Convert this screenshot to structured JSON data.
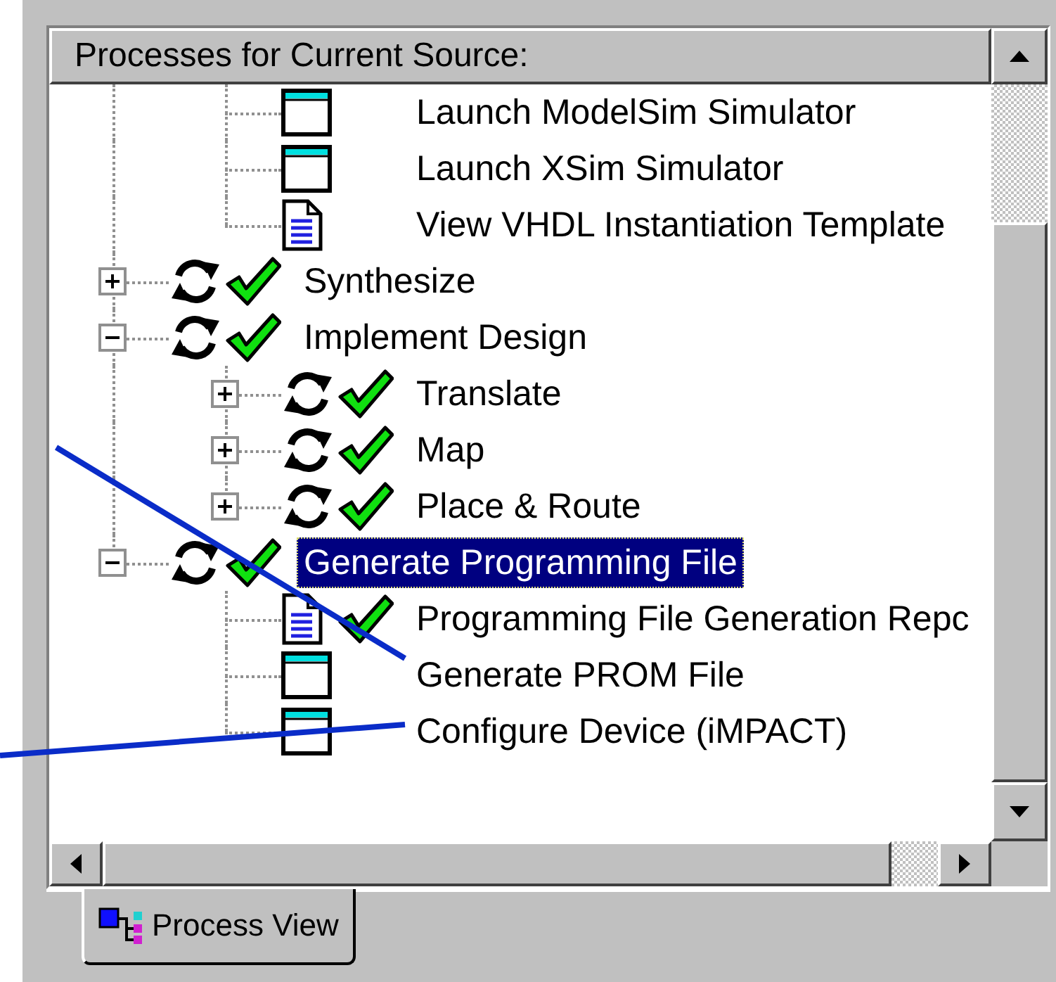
{
  "panel": {
    "title": "Processes for Current Source:"
  },
  "tree": {
    "scrolled_parent_children": [
      {
        "label": "Launch ModelSim Simulator",
        "kind": "tool",
        "done": false,
        "selected": false
      },
      {
        "label": "Launch XSim Simulator",
        "kind": "tool",
        "done": false,
        "selected": false
      },
      {
        "label": "View VHDL Instantiation Template",
        "kind": "doc",
        "done": false,
        "selected": false
      }
    ],
    "items": [
      {
        "label": "Synthesize",
        "kind": "process",
        "done": true,
        "expanded": false,
        "selected": false
      },
      {
        "label": "Implement Design",
        "kind": "process",
        "done": true,
        "expanded": true,
        "selected": false,
        "children": [
          {
            "label": "Translate",
            "kind": "process",
            "done": true,
            "expanded": false,
            "selected": false
          },
          {
            "label": "Map",
            "kind": "process",
            "done": true,
            "expanded": false,
            "selected": false
          },
          {
            "label": "Place & Route",
            "kind": "process",
            "done": true,
            "expanded": false,
            "selected": false
          }
        ]
      },
      {
        "label": "Generate Programming File",
        "kind": "process",
        "done": true,
        "expanded": true,
        "selected": true,
        "children": [
          {
            "label": "Programming File Generation Repc",
            "kind": "doc",
            "done": true,
            "selected": false
          },
          {
            "label": "Generate PROM File",
            "kind": "tool",
            "done": false,
            "selected": false
          },
          {
            "label": "Configure Device (iMPACT)",
            "kind": "tool",
            "done": false,
            "selected": false
          }
        ]
      }
    ]
  },
  "tabs": [
    {
      "label": "Process View",
      "selected": true
    }
  ]
}
